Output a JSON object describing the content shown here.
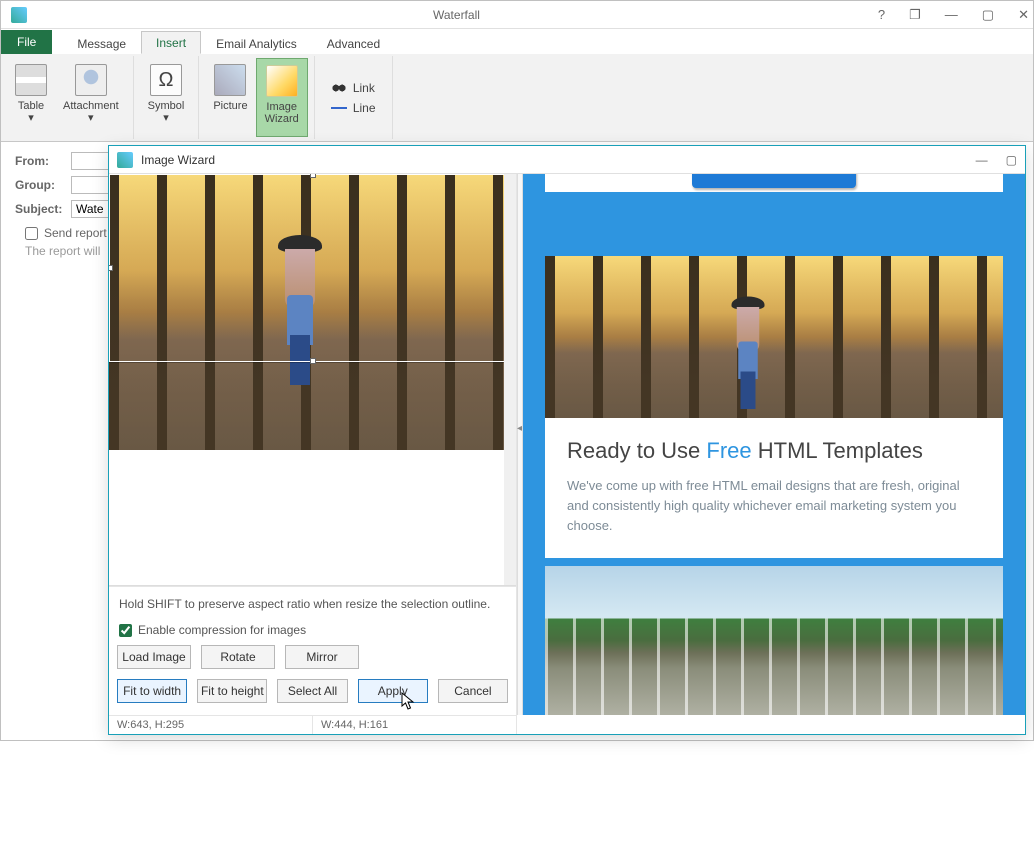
{
  "window": {
    "title": "Waterfall",
    "controls": {
      "help": "?",
      "restore_small": "❐",
      "min": "—",
      "max": "▢",
      "close": "✕"
    }
  },
  "ribbon": {
    "file": "File",
    "tabs": [
      "Message",
      "Insert",
      "Email Analytics",
      "Advanced"
    ],
    "active_tab": "Insert",
    "buttons": {
      "table": "Table\n▾",
      "attachment": "Attachment\n▾",
      "symbol": "Symbol\n▾",
      "picture": "Picture",
      "image_wizard": "Image\nWizard",
      "link": "Link",
      "line": "Line"
    },
    "symbol_glyph": "Ω"
  },
  "form": {
    "from_label": "From:",
    "group_label": "Group:",
    "subject_label": "Subject:",
    "subject_value": "Wate",
    "send_report_label": "Send report aft",
    "hint": "The report will "
  },
  "dialog": {
    "title": "Image Wizard",
    "controls": {
      "min": "—",
      "max": "▢",
      "close": "✕"
    },
    "msg": "Hold SHIFT to preserve aspect ratio when resize the selection outline.",
    "compress_label": "Enable compression for images",
    "compress_checked": true,
    "buttons": {
      "load": "Load Image",
      "rotate": "Rotate",
      "mirror": "Mirror",
      "fit_w": "Fit to width",
      "fit_h": "Fit to height",
      "select_all": "Select All",
      "apply": "Apply",
      "cancel": "Cancel"
    },
    "status": {
      "full": "W:643, H:295",
      "sel": "W:444, H:161"
    }
  },
  "preview": {
    "heading_pre": "Ready to Use ",
    "heading_accent": "Free",
    "heading_post": " HTML Templates",
    "body": "We've come up with free HTML email designs that are fresh, original and consistently high quality whichever email marketing system you choose."
  }
}
